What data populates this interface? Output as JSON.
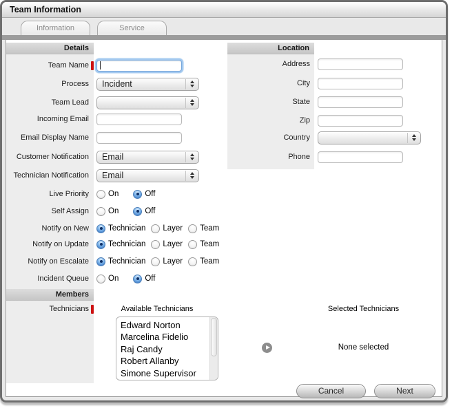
{
  "window": {
    "title": "Team Information"
  },
  "tabs": {
    "information": "Information",
    "service": "Service"
  },
  "opts": {
    "on": "On",
    "off": "Off",
    "technician": "Technician",
    "layer": "Layer",
    "team": "Team"
  },
  "details": {
    "header": "Details",
    "team_name": "Team Name",
    "team_name_value": "",
    "process": "Process",
    "process_value": "Incident",
    "team_lead": "Team Lead",
    "team_lead_value": "",
    "incoming_email": "Incoming Email",
    "incoming_email_value": "",
    "email_display_name": "Email Display Name",
    "email_display_name_value": "",
    "customer_notification": "Customer Notification",
    "customer_notification_value": "Email",
    "technician_notification": "Technician Notification",
    "technician_notification_value": "Email",
    "live_priority": "Live Priority",
    "live_priority_value": "Off",
    "self_assign": "Self Assign",
    "self_assign_value": "Off",
    "notify_on_new": "Notify on New",
    "notify_on_new_value": "Technician",
    "notify_on_update": "Notify on Update",
    "notify_on_update_value": "Technician",
    "notify_on_escalate": "Notify on Escalate",
    "notify_on_escalate_value": "Technician",
    "incident_queue": "Incident Queue",
    "incident_queue_value": "Off"
  },
  "location": {
    "header": "Location",
    "address": "Address",
    "address_value": "",
    "city": "City",
    "city_value": "",
    "state": "State",
    "state_value": "",
    "zip": "Zip",
    "zip_value": "",
    "country": "Country",
    "country_value": "",
    "phone": "Phone",
    "phone_value": ""
  },
  "members": {
    "header": "Members",
    "technicians": "Technicians",
    "available_title": "Available Technicians",
    "selected_title": "Selected Technicians",
    "none_selected": "None selected",
    "available": [
      "Edward Norton",
      "Marcelina Fidelio",
      "Raj Candy",
      "Robert Allanby",
      "Simone Supervisor"
    ]
  },
  "footer": {
    "cancel": "Cancel",
    "next": "Next"
  },
  "colors": {
    "focus_ring": "#84b7ea",
    "required_marker": "#cc1111",
    "radio_selected_blue": "#2e6fc0",
    "section_header_gray": "#cfcfcf",
    "tab_bar_gray": "#9c9c9c"
  }
}
